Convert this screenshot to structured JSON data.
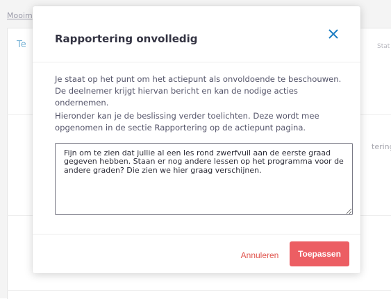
{
  "background": {
    "breadcrumb": "Mooim",
    "section_heading": "Te",
    "status_header": "Stat",
    "row_snippet": "tering g"
  },
  "modal": {
    "title": "Rapportering onvolledig",
    "close_icon": "close-x-icon",
    "paragraph1": "Je staat op het punt om het actiepunt als onvoldoende te beschouwen. De deelnemer krijgt hiervan bericht en kan de nodige acties ondernemen.",
    "paragraph2": "Hieronder kan je de beslissing verder toelichten. Deze wordt mee opgenomen in de sectie Rapportering op de actiepunt pagina.",
    "comment_value": "Fijn om te zien dat jullie al een les rond zwerfvuil aan de eerste graad gegeven hebben. Staan er nog andere lessen op het programma voor de andere graden? Die zien we hier graag verschijnen.",
    "cancel_label": "Annuleren",
    "apply_label": "Toepassen"
  },
  "colors": {
    "accent": "#ec5e63",
    "cancel_text": "#e0564f",
    "close_icon": "#1f7fc4"
  }
}
